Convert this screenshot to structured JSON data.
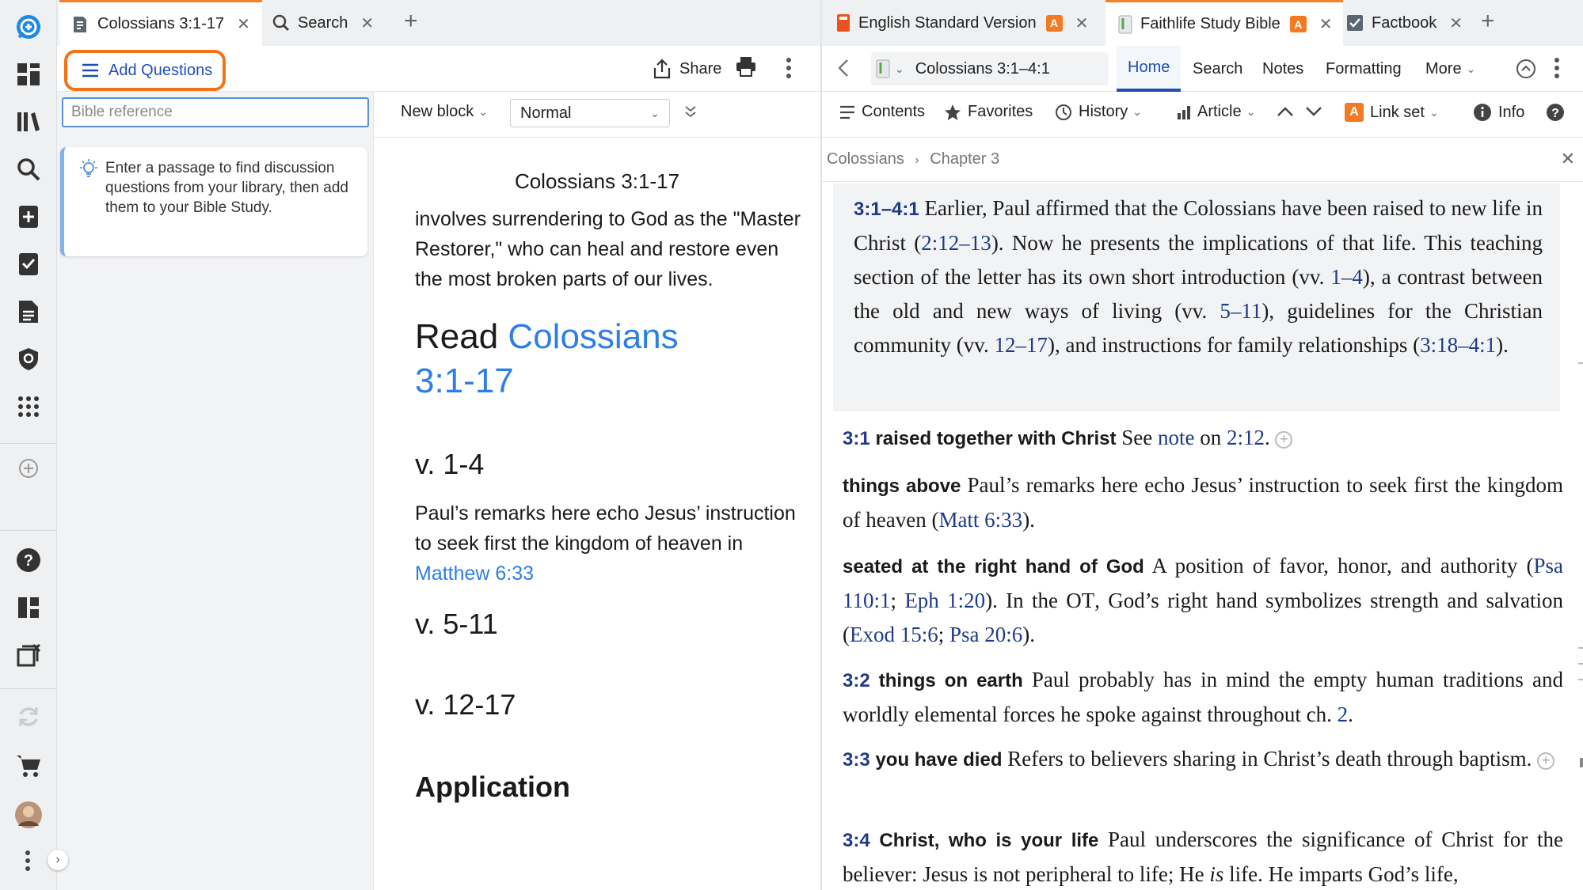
{
  "left_tabs": [
    {
      "label": "Colossians 3:1-17",
      "active": true
    },
    {
      "label": "Search",
      "active": false
    }
  ],
  "right_tabs": [
    {
      "label": "English Standard Version",
      "badge": "A",
      "active": false
    },
    {
      "label": "Faithlife Study Bible",
      "badge": "A",
      "active": true
    },
    {
      "label": "Factbook",
      "active": false
    }
  ],
  "study_toolbar": {
    "add_questions": "Add Questions",
    "share": "Share"
  },
  "sidebar": {
    "placeholder": "Bible reference",
    "hint": "Enter a passage to find discussion questions from your library, then add them to your Bible Study."
  },
  "edit_toolbar": {
    "block": "New block",
    "style": "Normal"
  },
  "doc": {
    "title": "Colossians 3:1-17",
    "para1": "involves surrendering to God as the \"Master Restorer,\" who can heal and restore even the most broken parts of our lives.",
    "read_prefix": "Read",
    "read_ref": "Colossians 3:1-17",
    "h1": "v. 1-4",
    "para2_text": "Paul’s remarks here echo Jesus’ instruction to seek first the kingdom of heaven in",
    "para2_link": "Matthew 6:33",
    "h2": "v. 5-11",
    "h3": "v. 12-17",
    "h4": "Application"
  },
  "reader_nav": {
    "ref": "Colossians 3:1–4:1",
    "tabs": [
      "Home",
      "Search",
      "Notes",
      "Formatting",
      "More"
    ]
  },
  "reader_tools": {
    "contents": "Contents",
    "favorites": "Favorites",
    "history": "History",
    "article": "Article",
    "link_set": "Link set",
    "link_badge": "A",
    "info": "Info"
  },
  "breadcrumb": [
    "Colossians",
    "Chapter 3"
  ],
  "article": {
    "intro": {
      "ref": "3:1–4:1",
      "t1": " Earlier, Paul affirmed that the Colossians have been raised to new life in Christ (",
      "r1": "2:12–13",
      "t2": "). Now he presents the implications of that life. This teaching section of the letter has its own short introduction (vv. ",
      "r2": "1–4",
      "t3": "), a contrast between the old and new ways of living (vv. ",
      "r3": "5–11",
      "t4": "), guidelines for the Christian community (vv. ",
      "r4": "12–17",
      "t5": "), and instructions for family relationships (",
      "r5": "3:18–4:1",
      "t6": ")."
    },
    "n1": {
      "ref": "3:1",
      "lemma": "raised together with Christ",
      "t1": " See ",
      "r1": "note",
      "t2": " on ",
      "r2": "2:12",
      "t3": "."
    },
    "n2": {
      "lemma": "things above",
      "t1": " Paul’s remarks here echo Jesus’ instruction to seek first the kingdom of heaven (",
      "r1": "Matt 6:33",
      "t2": ")."
    },
    "n3": {
      "lemma": "seated at the right hand of God",
      "t1": " A position of favor, honor, and authority (",
      "r1": "Psa 110:1",
      "t2": "; ",
      "r2": "Eph 1:20",
      "t3": "). In the ",
      "ot": "OT",
      "t4": ", God’s right hand symbolizes strength and salvation (",
      "r3": "Exod 15:6",
      "t5": "; ",
      "r4": "Psa 20:6",
      "t6": ")."
    },
    "n4": {
      "ref": "3:2",
      "lemma": "things on earth",
      "t1": " Paul probably has in mind the empty human traditions and worldly elemental forces he spoke against throughout ch. ",
      "r1": "2",
      "t2": "."
    },
    "n5": {
      "ref": "3:3",
      "lemma": "you have died",
      "t1": " Refers to believers sharing in Christ’s death through baptism."
    },
    "n6": {
      "ref": "3:4",
      "lemma": "Christ, who is your life",
      "t1": " Paul underscores the significance of Christ for the believer: Jesus is not peripheral to life; He ",
      "em": "is",
      "t2": " life. He imparts God’s life,"
    }
  },
  "colors": {
    "accent": "#f47216",
    "link": "#2d7ee8",
    "ref": "#1e3a8a",
    "active_tab": "#1e4fb8"
  }
}
